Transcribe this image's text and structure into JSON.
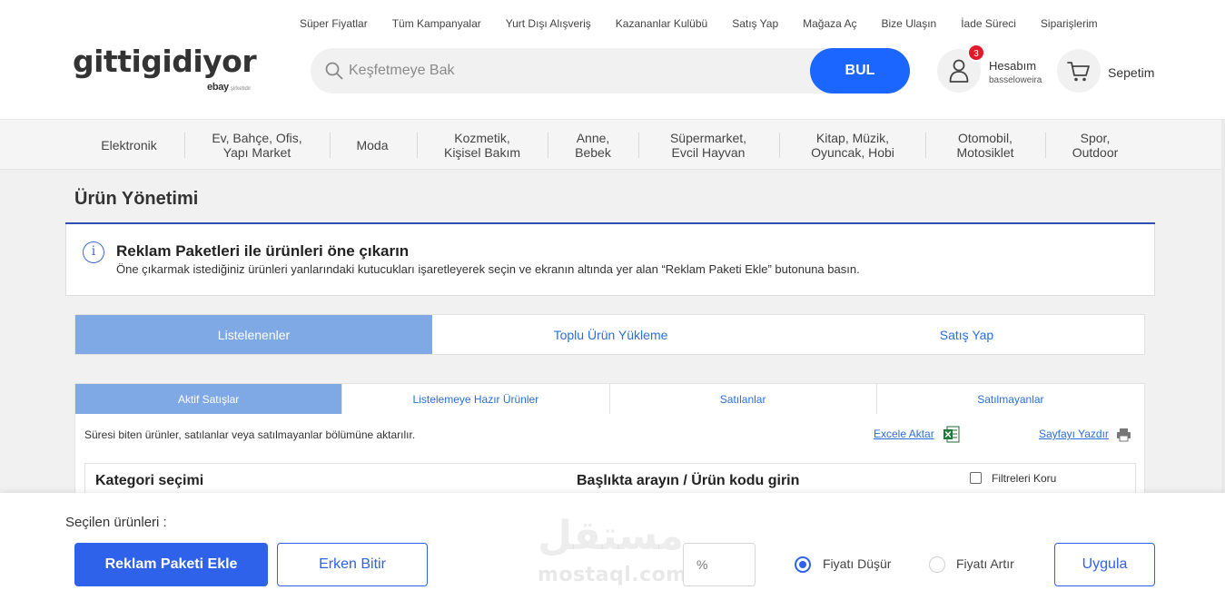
{
  "top_links": [
    "Süper Fiyatlar",
    "Tüm Kampanyalar",
    "Yurt Dışı Alışveriş",
    "Kazananlar Kulübü",
    "Satış Yap",
    "Mağaza Aç",
    "Bize Ulaşın",
    "İade Süreci",
    "Siparişlerim"
  ],
  "logo": {
    "brand": "gittigidiyor",
    "sub_brand": "ebay",
    "sub_note": "şirketidir"
  },
  "search": {
    "placeholder": "Keşfetmeye Bak",
    "button": "BUL"
  },
  "account": {
    "label": "Hesabım",
    "username": "basseloweira",
    "badge": "3"
  },
  "cart": {
    "label": "Sepetim"
  },
  "categories": [
    {
      "line1": "Elektronik",
      "line2": ""
    },
    {
      "line1": "Ev, Bahçe, Ofis,",
      "line2": "Yapı Market"
    },
    {
      "line1": "Moda",
      "line2": ""
    },
    {
      "line1": "Kozmetik,",
      "line2": "Kişisel Bakım"
    },
    {
      "line1": "Anne,",
      "line2": "Bebek"
    },
    {
      "line1": "Süpermarket,",
      "line2": "Evcil Hayvan"
    },
    {
      "line1": "Kitap, Müzik,",
      "line2": "Oyuncak, Hobi"
    },
    {
      "line1": "Otomobil,",
      "line2": "Motosiklet"
    },
    {
      "line1": "Spor,",
      "line2": "Outdoor"
    }
  ],
  "page": {
    "title": "Ürün Yönetimi"
  },
  "info": {
    "heading": "Reklam Paketleri ile ürünleri öne çıkarın",
    "description": "Öne çıkarmak istediğiniz ürünleri yanlarındaki kutucukları işaretleyerek seçin ve ekranın altında yer alan “Reklam Paketi Ekle” butonuna basın."
  },
  "main_tabs": [
    "Listelenenler",
    "Toplu Ürün Yükleme",
    "Satış Yap"
  ],
  "sub_tabs": [
    "Aktif Satışlar",
    "Listelemeye Hazır Ürünler",
    "Satılanlar",
    "Satılmayanlar"
  ],
  "list": {
    "note": "Süresi biten ürünler, satılanlar veya satılmayanlar bölümüne aktarılır.",
    "excel": "Excele Aktar",
    "print": "Sayfayı Yazdır",
    "category_label": "Kategori seçimi",
    "search_label": "Başlıkta arayın / Ürün kodu girin",
    "keep_filters": "Filtreleri Koru"
  },
  "bottom": {
    "selected_label": "Seçilen ürünleri :",
    "add_package": "Reklam Paketi Ekle",
    "end_early": "Erken Bitir",
    "percent_placeholder": "%",
    "price_down": "Fiyatı Düşür",
    "price_up": "Fiyatı Artır",
    "apply": "Uygula",
    "selected_option": "Fiyatı Düşür"
  },
  "watermark": {
    "arabic": "مستقل",
    "latin": "mostaql.com"
  },
  "colors": {
    "primary": "#2f62ea",
    "search_button": "#1a66ff",
    "active_tab": "#7fa9e4",
    "badge": "#e2192a",
    "title_rule": "#2e4fae"
  }
}
